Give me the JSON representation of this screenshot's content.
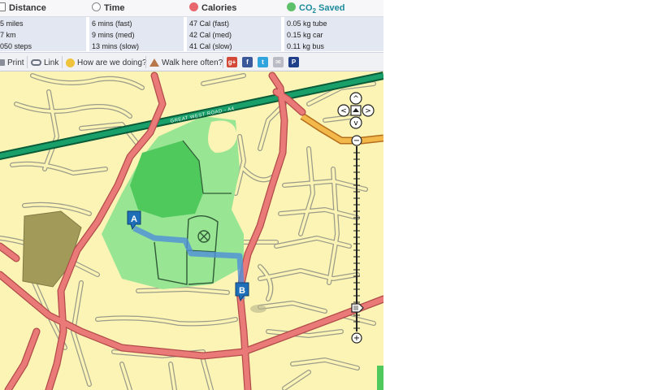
{
  "stats": {
    "distance": {
      "label": "Distance",
      "lines": [
        "5 miles",
        "7 km",
        "050 steps"
      ]
    },
    "time": {
      "label": "Time",
      "lines": [
        "6 mins (fast)",
        "9 mins (med)",
        "13 mins (slow)"
      ]
    },
    "calories": {
      "label": "Calories",
      "lines": [
        "47 Cal (fast)",
        "42 Cal (med)",
        "41 Cal (slow)"
      ]
    },
    "co2": {
      "label": "CO2 Saved",
      "label_main": "CO",
      "label_sub": "2",
      "label_rest": " Saved",
      "lines": [
        "0.05 kg tube",
        "0.15 kg car",
        "0.11 kg bus"
      ]
    }
  },
  "toolbar": {
    "print": "Print",
    "link": "Link",
    "feedback": "How are we doing?",
    "walk_often": "Walk here often?",
    "social": [
      {
        "name": "google-plus",
        "glyph": "g+",
        "color": "#d34836"
      },
      {
        "name": "facebook",
        "glyph": "f",
        "color": "#3b5998"
      },
      {
        "name": "twitter",
        "glyph": "t",
        "color": "#2fa4dd"
      },
      {
        "name": "email",
        "glyph": "✉",
        "color": "#b9bcc4"
      },
      {
        "name": "parking",
        "glyph": "P",
        "color": "#1f3f8a"
      }
    ]
  },
  "map": {
    "road_label": "GREAT WEST ROAD - A4",
    "marker_start": "A",
    "marker_end": "B",
    "colors": {
      "land": "#fbf4b4",
      "park": "#98e594",
      "park_dark": "#4fc85c",
      "major_road": "#e97a78",
      "motorway": "#0f7a4b",
      "route": "#4f8ed9",
      "industrial": "#a29a59"
    },
    "controls": {
      "pan_up": "^",
      "pan_down": "v",
      "pan_left": "<",
      "pan_right": ">",
      "zoom_out": "−",
      "zoom_in": "+"
    }
  }
}
